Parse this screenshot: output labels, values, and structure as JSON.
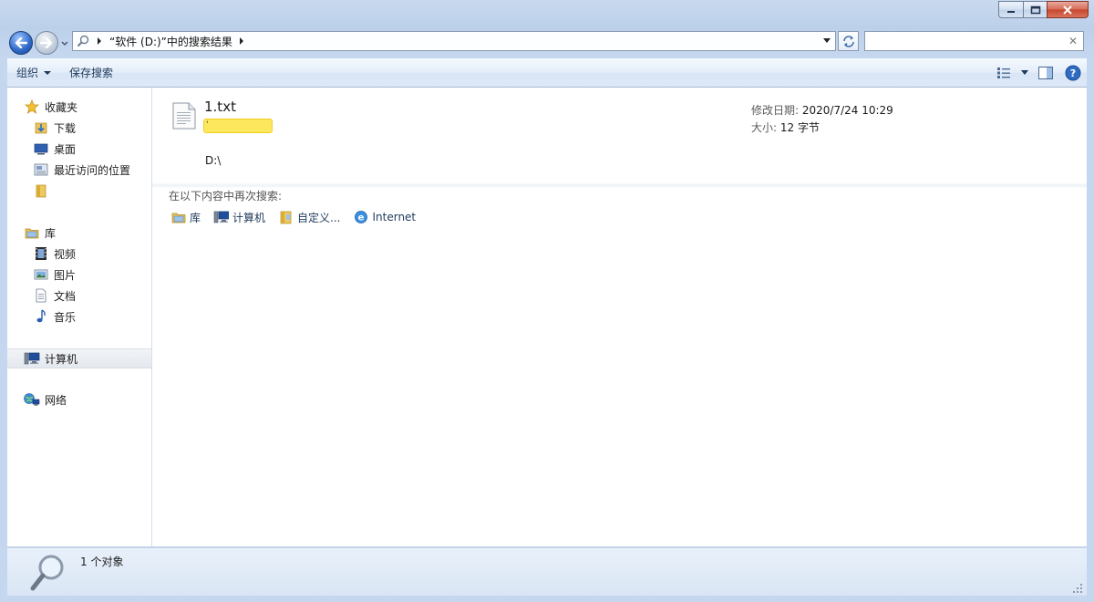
{
  "window": {
    "controls": {
      "minimize": "minimize-icon",
      "maximize": "maximize-icon",
      "close": "close-icon"
    }
  },
  "address": {
    "crumb": "“软件 (D:)”中的搜索结果",
    "icon": "search-icon"
  },
  "search": {
    "placeholder": "",
    "value": ""
  },
  "toolbar": {
    "organize_label": "组织",
    "save_search_label": "保存搜索"
  },
  "nav": {
    "favorites": "收藏夹",
    "downloads": "下载",
    "desktop": "桌面",
    "recent": "最近访问的位置",
    "libraries": "库",
    "videos": "视频",
    "pictures": "图片",
    "documents": "文档",
    "music": "音乐",
    "computer": "计算机",
    "network": "网络"
  },
  "result": {
    "name": "1.txt",
    "snippet": "'",
    "location": "D:\\",
    "date_label": "修改日期:",
    "date_value": "2020/7/24 10:29",
    "size_label": "大小:",
    "size_value": "12 字节"
  },
  "search_again": {
    "heading": "在以下内容中再次搜索:",
    "items": [
      "库",
      "计算机",
      "自定义...",
      "Internet"
    ]
  },
  "status": {
    "count": "1 个对象"
  },
  "colors": {
    "accent": "#1e395b",
    "highlight": "#fde85d",
    "frame": "#c9d9ee"
  }
}
